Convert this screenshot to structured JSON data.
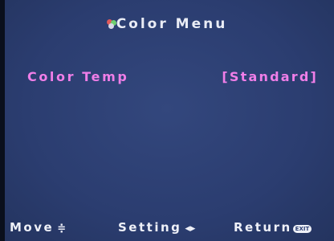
{
  "menu": {
    "title": "Color Menu",
    "title_icon": "color-palette-icon"
  },
  "settings": [
    {
      "label": "Color Temp",
      "value": "[Standard]"
    }
  ],
  "footer": {
    "move_label": "Move",
    "move_glyph": "≑",
    "setting_label": "Setting",
    "setting_glyph": "◂▸",
    "return_label": "Return",
    "return_badge": "EXIT"
  },
  "colors": {
    "background": "#2c3f73",
    "highlight": "#f07ee8",
    "text": "#eef0f8"
  }
}
